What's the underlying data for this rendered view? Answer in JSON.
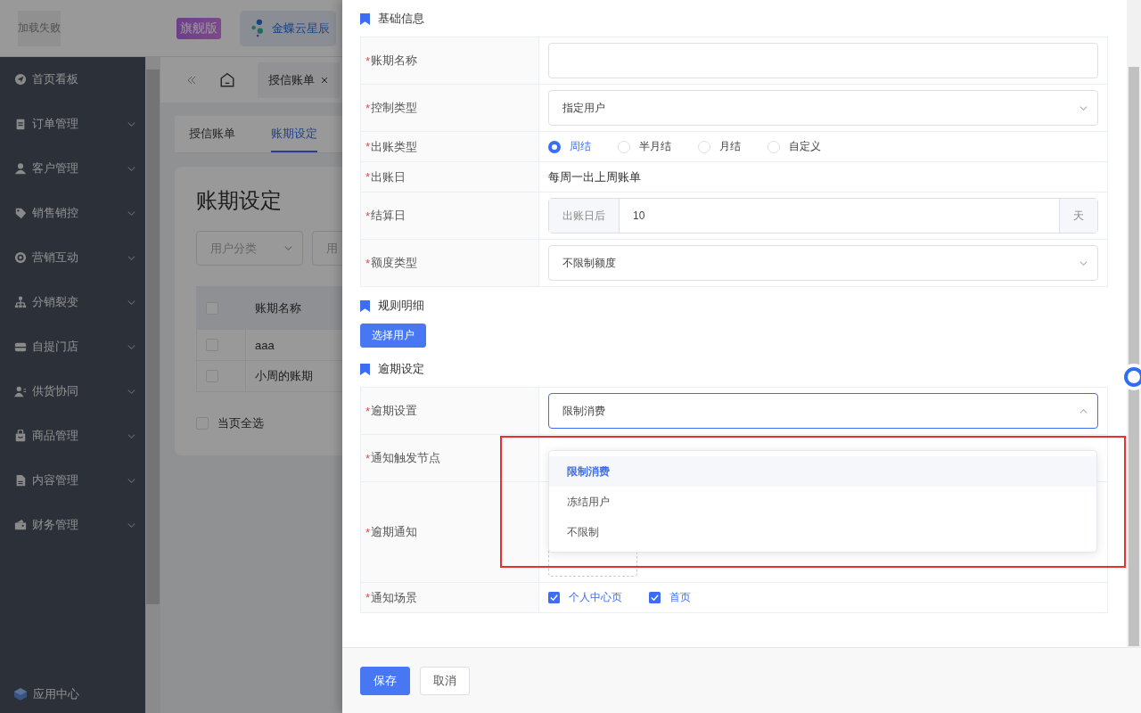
{
  "app_header": {
    "logo_text": "加载失败",
    "edition_badge": "旗舰版",
    "product": "金蝶云星辰",
    "product_selected": true
  },
  "sidebar": {
    "items": [
      {
        "label": "首页看板",
        "has_children": false
      },
      {
        "label": "订单管理",
        "has_children": true
      },
      {
        "label": "客户管理",
        "has_children": true
      },
      {
        "label": "销售销控",
        "has_children": true
      },
      {
        "label": "营销互动",
        "has_children": true
      },
      {
        "label": "分销裂变",
        "has_children": true
      },
      {
        "label": "自提门店",
        "has_children": true
      },
      {
        "label": "供货协同",
        "has_children": true
      },
      {
        "label": "商品管理",
        "has_children": true
      },
      {
        "label": "内容管理",
        "has_children": true
      },
      {
        "label": "财务管理",
        "has_children": true
      }
    ],
    "footer_item": "应用中心"
  },
  "page_tabs": [
    {
      "label": "授信账单",
      "selected": true
    }
  ],
  "sub_tabs": [
    {
      "label": "授信账单",
      "selected": false
    },
    {
      "label": "账期设定",
      "selected": true
    }
  ],
  "page_title": "账期设定",
  "filters": [
    {
      "placeholder": "用户分类"
    },
    {
      "placeholder": "用"
    }
  ],
  "table": {
    "header_checked": false,
    "columns": [
      "账期名称"
    ],
    "rows": [
      {
        "name": "aaa",
        "checked": false
      },
      {
        "name": "小周的账期",
        "checked": false
      }
    ]
  },
  "select_all": {
    "label": "当页全选",
    "checked": false
  },
  "drawer": {
    "sections": [
      {
        "title": "基础信息",
        "kind": "form",
        "rows": [
          {
            "label": "账期名称",
            "required_mark": "*",
            "kind": "input"
          },
          {
            "label": "控制类型",
            "required_mark": "*",
            "kind": "select",
            "value": "指定用户",
            "open": false
          },
          {
            "label": "出账类型",
            "required_mark": "*",
            "kind": "radio",
            "options": [
              {
                "label": "周结",
                "selected": true
              },
              {
                "label": "半月结",
                "selected": false
              },
              {
                "label": "月结",
                "selected": false
              },
              {
                "label": "自定义",
                "selected": false
              }
            ]
          },
          {
            "label": "出账日",
            "required_mark": "*",
            "kind": "text",
            "value": "每周一出上周账单"
          },
          {
            "label": "结算日",
            "required_mark": "*",
            "kind": "addon_input",
            "prefix": "出账日后",
            "value": "10",
            "suffix": "天"
          },
          {
            "label": "额度类型",
            "required_mark": "*",
            "kind": "select",
            "value": "不限制额度",
            "open": false
          }
        ]
      },
      {
        "title": "规则明细",
        "kind": "actions",
        "buttons": [
          "选择用户"
        ]
      },
      {
        "title": "逾期设定",
        "kind": "form",
        "rows": [
          {
            "label": "逾期设置",
            "required_mark": "*",
            "kind": "select",
            "value": "限制消费",
            "open": true
          },
          {
            "label": "通知触发节点",
            "required_mark": "*",
            "kind": "empty"
          },
          {
            "label": "逾期通知",
            "required_mark": "*",
            "kind": "upload"
          },
          {
            "label": "通知场景",
            "required_mark": "*",
            "kind": "checkbox",
            "options": [
              {
                "label": "个人中心页",
                "checked": true
              },
              {
                "label": "首页",
                "checked": true
              }
            ]
          }
        ]
      }
    ],
    "dropdown": {
      "options": [
        {
          "label": "限制消费",
          "selected": true
        },
        {
          "label": "冻结用户",
          "selected": false
        },
        {
          "label": "不限制",
          "selected": false
        }
      ]
    },
    "footer_buttons": [
      {
        "label": "保存",
        "kind": "primary"
      },
      {
        "label": "取消",
        "kind": "default"
      }
    ]
  }
}
